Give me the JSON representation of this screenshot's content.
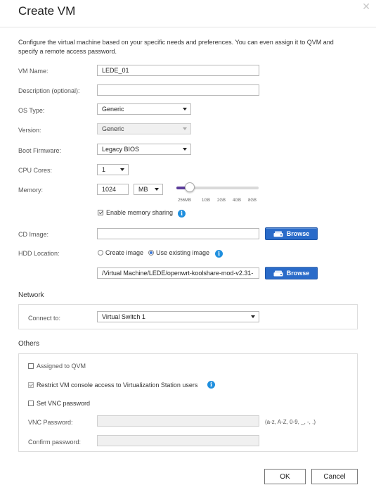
{
  "dialog": {
    "title": "Create VM",
    "close_icon": "close-icon",
    "intro": "Configure the virtual machine based on your specific needs and preferences. You can even assign it to QVM and specify a remote access password."
  },
  "form": {
    "vm_name": {
      "label": "VM Name:",
      "value": "LEDE_01"
    },
    "description": {
      "label": "Description (optional):",
      "value": ""
    },
    "os_type": {
      "label": "OS Type:",
      "value": "Generic"
    },
    "version": {
      "label": "Version:",
      "value": "Generic"
    },
    "boot_firmware": {
      "label": "Boot Firmware:",
      "value": "Legacy BIOS"
    },
    "cpu_cores": {
      "label": "CPU Cores:",
      "value": "1"
    },
    "memory": {
      "label": "Memory:",
      "value": "1024",
      "unit": "MB",
      "slider_fraction": 0.16,
      "ticks": [
        "256MB",
        "1GB",
        "2GB",
        "4GB",
        "8GB"
      ],
      "sharing_label": "Enable memory sharing",
      "sharing_checked": true
    },
    "cd_image": {
      "label": "CD Image:",
      "value": "",
      "browse_label": "Browse"
    },
    "hdd_location": {
      "label": "HDD Location:",
      "option_create": "Create image",
      "option_existing": "Use existing image",
      "selected": "existing",
      "path": "/Virtual Machine/LEDE/openwrt-koolshare-mod-v2.31-",
      "browse_label": "Browse"
    }
  },
  "network": {
    "title": "Network",
    "connect_label": "Connect to:",
    "connect_value": "Virtual Switch 1"
  },
  "others": {
    "title": "Others",
    "assigned_qvm": {
      "label": "Assigned to QVM",
      "checked": false
    },
    "restrict_console": {
      "label": "Restrict VM console access to Virtualization Station users",
      "checked": true
    },
    "set_vnc": {
      "label": "Set VNC password",
      "checked": false
    },
    "vnc_password": {
      "label": "VNC Password:",
      "value": "",
      "hint": "(a-z, A-Z, 0-9, _, -, .)"
    },
    "confirm_password": {
      "label": "Confirm password:",
      "value": ""
    }
  },
  "footer": {
    "ok_label": "OK",
    "cancel_label": "Cancel"
  },
  "colors": {
    "accent": "#2a6bc9",
    "slider": "#5b3c9a",
    "info": "#1f8fde"
  }
}
